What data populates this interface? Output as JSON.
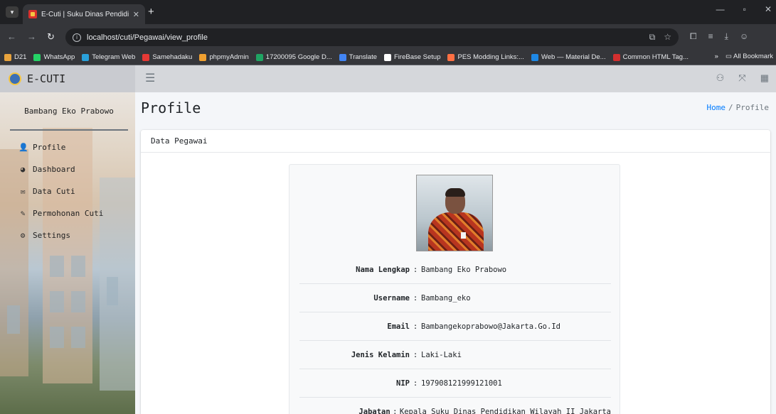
{
  "browser": {
    "tab_title": "E-Cuti | Suku Dinas Pendidikan",
    "url": "localhost/cuti/Pegawai/view_profile",
    "bookmarks": [
      {
        "label": "D21",
        "color": "#e8a33d"
      },
      {
        "label": "WhatsApp",
        "color": "#25d366"
      },
      {
        "label": "Telegram Web",
        "color": "#2aa1da"
      },
      {
        "label": "Samehadaku",
        "color": "#e53935"
      },
      {
        "label": "phpmyAdmin",
        "color": "#f0a030"
      },
      {
        "label": "17200095 Google D...",
        "color": "#1fa463"
      },
      {
        "label": "Translate",
        "color": "#4285f4"
      },
      {
        "label": "FireBase Setup",
        "color": "#ffffff"
      },
      {
        "label": "PES Modding Links:...",
        "color": "#ff7043"
      },
      {
        "label": "Web — Material De...",
        "color": "#1e88e5"
      },
      {
        "label": "Common HTML Tag...",
        "color": "#d32f2f"
      }
    ],
    "all_bookmarks_label": "All Bookmark"
  },
  "app": {
    "brand": "E-CUTI",
    "user_name": "Bambang Eko Prabowo",
    "menu": [
      {
        "label": "Profile",
        "icon": "user-icon"
      },
      {
        "label": "Dashboard",
        "icon": "dashboard-icon"
      },
      {
        "label": "Data Cuti",
        "icon": "envelope-icon"
      },
      {
        "label": "Permohonan Cuti",
        "icon": "edit-icon"
      },
      {
        "label": "Settings",
        "icon": "gear-icon"
      }
    ]
  },
  "page": {
    "title": "Profile",
    "breadcrumb": {
      "home": "Home",
      "separator": "/",
      "current": "Profile"
    },
    "card_title": "Data Pegawai"
  },
  "profile": {
    "fields": [
      {
        "label": "Nama Lengkap",
        "value": "Bambang Eko Prabowo"
      },
      {
        "label": "Username",
        "value": "Bambang_eko"
      },
      {
        "label": "Email",
        "value": "Bambangekoprabowo@Jakarta.Go.Id"
      },
      {
        "label": "Jenis Kelamin",
        "value": "Laki-Laki"
      },
      {
        "label": "NIP",
        "value": "197908121999121001"
      },
      {
        "label": "Jabatan",
        "value": "Kepala Suku Dinas Pendidikan Wilayah II Jakarta"
      }
    ]
  }
}
